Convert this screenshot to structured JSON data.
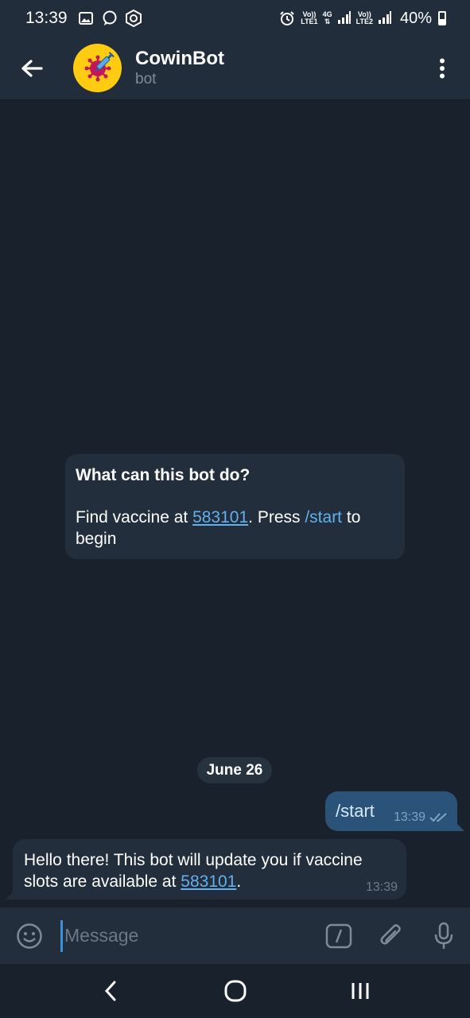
{
  "status_bar": {
    "time": "13:39",
    "net1_top": "Vo))",
    "net1_bottom": "LTE1",
    "net_type": "4G",
    "net2_top": "Vo))",
    "net2_bottom": "LTE2",
    "battery_percent": "40%",
    "battery_level": 0.4,
    "icons": [
      "gallery-icon",
      "chat-bubble-icon",
      "hexagon-app-icon",
      "alarm-icon",
      "signal-icon",
      "battery-icon"
    ]
  },
  "header": {
    "title": "CowinBot",
    "subtitle": "bot",
    "avatar_bg": "#ffcc11"
  },
  "info_card": {
    "heading": "What can this bot do?",
    "text_before": "Find vaccine at ",
    "link": "583101",
    "text_mid": ". Press ",
    "command": "/start",
    "text_after": " to begin"
  },
  "date_divider": "June 26",
  "messages": [
    {
      "direction": "out",
      "text": "/start",
      "time": "13:39",
      "status": "read"
    },
    {
      "direction": "in",
      "text_before": "Hello there! This bot will update you if vaccine slots are available at ",
      "link": "583101",
      "text_after": ".",
      "time": "13:39"
    }
  ],
  "input": {
    "placeholder": "Message"
  },
  "colors": {
    "background": "#19212c",
    "header": "#212d3b",
    "bubble_in": "#222e3b",
    "bubble_out": "#2b5278",
    "link": "#62b0ec"
  }
}
